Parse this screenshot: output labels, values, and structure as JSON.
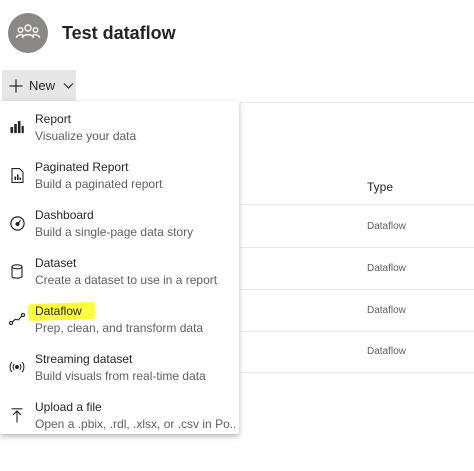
{
  "header": {
    "title": "Test dataflow",
    "avatar_icon": "people-group-icon"
  },
  "toolbar": {
    "new_label": "New",
    "new_icon": "plus-icon",
    "chevron_icon": "chevron-down-icon"
  },
  "list": {
    "type_header": "Type",
    "rows": [
      "Dataflow",
      "Dataflow",
      "Dataflow",
      "Dataflow"
    ]
  },
  "menu": {
    "items": [
      {
        "title": "Report",
        "description": "Visualize your data",
        "icon": "bar-chart-icon"
      },
      {
        "title": "Paginated Report",
        "description": "Build a paginated report",
        "icon": "paginated-report-icon"
      },
      {
        "title": "Dashboard",
        "description": "Build a single-page data story",
        "icon": "gauge-icon"
      },
      {
        "title": "Dataset",
        "description": "Create a dataset to use in a report",
        "icon": "database-icon"
      },
      {
        "title": "Dataflow",
        "description": "Prep, clean, and transform data",
        "icon": "dataflow-icon",
        "highlighted": true
      },
      {
        "title": "Streaming dataset",
        "description": "Build visuals from real-time data",
        "icon": "streaming-icon"
      },
      {
        "title": "Upload a file",
        "description": "Open a .pbix, .rdl, .xlsx, or .csv in Po...",
        "icon": "upload-icon"
      }
    ]
  },
  "colors": {
    "highlight": "#ffff3a",
    "avatar": "#8a8886",
    "button_bg": "#e6e6e6"
  }
}
